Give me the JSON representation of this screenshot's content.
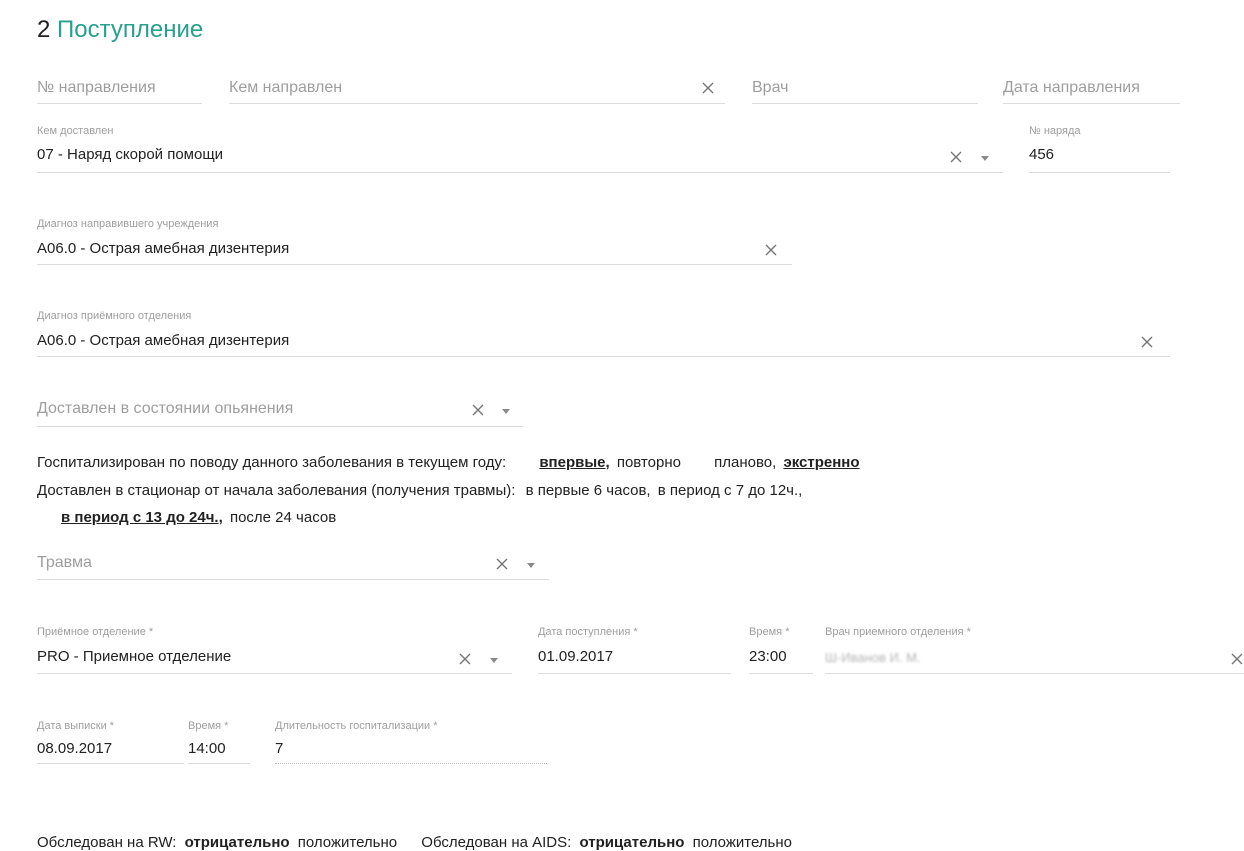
{
  "section": {
    "number": "2",
    "title": "Поступление"
  },
  "referral": {
    "number_placeholder": "№ направления",
    "referred_by_placeholder": "Кем направлен",
    "doctor_placeholder": "Врач",
    "date_placeholder": "Дата направления"
  },
  "delivery": {
    "label": "Кем доставлен",
    "value": "07 - Наряд скорой помощи",
    "order_label": "№ наряда",
    "order_value": "456"
  },
  "referring_diagnosis": {
    "label": "Диагноз направившего учреждения",
    "value": "A06.0 - Острая амебная дизентерия"
  },
  "admission_diagnosis": {
    "label": "Диагноз приёмного отделения",
    "value": "A06.0 - Острая амебная дизентерия"
  },
  "intoxication": {
    "placeholder": "Доставлен в состоянии опьянения"
  },
  "hospitalized": {
    "label": "Госпитализирован по поводу данного заболевания в текущем году:",
    "options": [
      {
        "text": "впервые,",
        "selected": true
      },
      {
        "text": "повторно",
        "selected": false
      },
      {
        "text": "планово,",
        "selected": false
      },
      {
        "text": "экстренно",
        "selected": true
      }
    ]
  },
  "delivered_time": {
    "label": "Доставлен в стационар от начала заболевания (получения травмы):",
    "options": [
      {
        "text": "в первые 6 часов,",
        "selected": false
      },
      {
        "text": "в период с 7 до 12ч.,",
        "selected": false
      },
      {
        "text": "в период с 13 до 24ч.,",
        "selected": true
      },
      {
        "text": "после 24 часов",
        "selected": false
      }
    ]
  },
  "trauma": {
    "placeholder": "Травма"
  },
  "admission": {
    "department_label": "Приёмное отделение *",
    "department_value": "PRO - Приемное отделение",
    "date_label": "Дата поступления *",
    "date_value": "01.09.2017",
    "time_label": "Время *",
    "time_value": "23:00",
    "doctor_label": "Врач приемного отделения *",
    "doctor_value": "Ш-Иванов И. М."
  },
  "discharge": {
    "date_label": "Дата выписки *",
    "date_value": "08.09.2017",
    "time_label": "Время *",
    "time_value": "14:00",
    "duration_label": "Длительность госпитализации *",
    "duration_value": "7"
  },
  "tests": {
    "rw_label": "Обследован на RW:",
    "rw_options": [
      {
        "text": "отрицательно",
        "selected": true
      },
      {
        "text": "положительно",
        "selected": false
      }
    ],
    "aids_label": "Обследован на AIDS:",
    "aids_options": [
      {
        "text": "отрицательно",
        "selected": true
      },
      {
        "text": "положительно",
        "selected": false
      }
    ]
  },
  "colors": {
    "accent": "#27a08e",
    "text": "#212121",
    "muted": "#9e9e9e",
    "line": "#dcdcdc"
  }
}
